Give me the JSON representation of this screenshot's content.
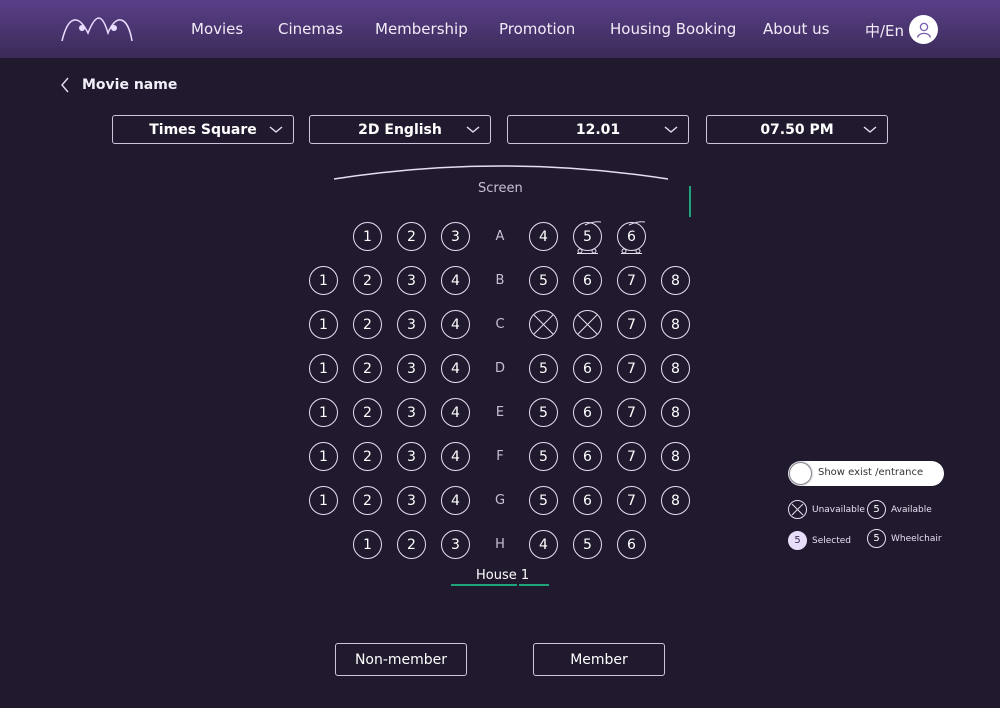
{
  "nav": {
    "items": [
      "Movies",
      "Cinemas",
      "Membership",
      "Promotion",
      "Housing Booking",
      "About us"
    ],
    "lang": "中/En"
  },
  "page": {
    "title": "Movie name"
  },
  "filters": {
    "cinema": "Times Square",
    "format": "2D English",
    "date": "12.01",
    "time": "07.50 PM"
  },
  "screen_label": "Screen",
  "house_label": "House 1",
  "rows": [
    {
      "label": "A",
      "left": [
        {
          "n": "1"
        },
        {
          "n": "2"
        },
        {
          "n": "3"
        }
      ],
      "right": [
        {
          "n": "4"
        },
        {
          "n": "5",
          "s": "wheelchair"
        },
        {
          "n": "6",
          "s": "wheelchair"
        }
      ]
    },
    {
      "label": "B",
      "left": [
        {
          "n": "1"
        },
        {
          "n": "2"
        },
        {
          "n": "3"
        },
        {
          "n": "4"
        }
      ],
      "right": [
        {
          "n": "5"
        },
        {
          "n": "6"
        },
        {
          "n": "7"
        },
        {
          "n": "8"
        }
      ]
    },
    {
      "label": "C",
      "left": [
        {
          "n": "1"
        },
        {
          "n": "2"
        },
        {
          "n": "3"
        },
        {
          "n": "4"
        }
      ],
      "right": [
        {
          "n": "",
          "s": "unavailable"
        },
        {
          "n": "",
          "s": "unavailable"
        },
        {
          "n": "7"
        },
        {
          "n": "8"
        }
      ]
    },
    {
      "label": "D",
      "left": [
        {
          "n": "1"
        },
        {
          "n": "2"
        },
        {
          "n": "3"
        },
        {
          "n": "4"
        }
      ],
      "right": [
        {
          "n": "5"
        },
        {
          "n": "6"
        },
        {
          "n": "7"
        },
        {
          "n": "8"
        }
      ]
    },
    {
      "label": "E",
      "left": [
        {
          "n": "1"
        },
        {
          "n": "2"
        },
        {
          "n": "3"
        },
        {
          "n": "4"
        }
      ],
      "right": [
        {
          "n": "5"
        },
        {
          "n": "6"
        },
        {
          "n": "7"
        },
        {
          "n": "8"
        }
      ]
    },
    {
      "label": "F",
      "left": [
        {
          "n": "1"
        },
        {
          "n": "2"
        },
        {
          "n": "3"
        },
        {
          "n": "4"
        }
      ],
      "right": [
        {
          "n": "5"
        },
        {
          "n": "6"
        },
        {
          "n": "7"
        },
        {
          "n": "8"
        }
      ]
    },
    {
      "label": "G",
      "left": [
        {
          "n": "1"
        },
        {
          "n": "2"
        },
        {
          "n": "3"
        },
        {
          "n": "4"
        }
      ],
      "right": [
        {
          "n": "5"
        },
        {
          "n": "6"
        },
        {
          "n": "7"
        },
        {
          "n": "8"
        }
      ]
    },
    {
      "label": "H",
      "left": [
        {
          "n": "1"
        },
        {
          "n": "2"
        },
        {
          "n": "3"
        }
      ],
      "right": [
        {
          "n": "4"
        },
        {
          "n": "5"
        },
        {
          "n": "6"
        }
      ]
    }
  ],
  "toggle": {
    "label": "Show exist /entrance",
    "on": false
  },
  "legend": {
    "unavailable": "Unavailable",
    "available": "Available",
    "available_sample": "5",
    "selected": "Selected",
    "selected_sample": "5",
    "wheelchair": "Wheelchair",
    "wheelchair_sample": "5"
  },
  "buttons": {
    "non_member": "Non-member",
    "member": "Member"
  },
  "colors": {
    "background": "#211a2e",
    "header": "#4b3573",
    "accent_green": "#1fa37a",
    "selected_fill": "#e9defa"
  }
}
